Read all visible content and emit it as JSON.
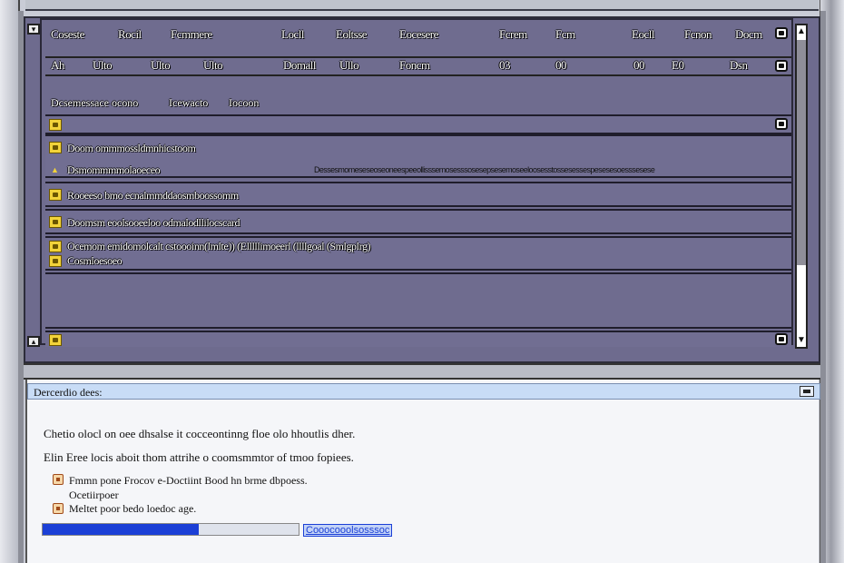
{
  "list": {
    "columns": [
      "Coseste",
      "Rocil",
      "Fcmmere",
      "Locll",
      "Eoltsse",
      "Eocesere",
      "Fcrem",
      "Fcm",
      "Eocll",
      "Fcnon",
      "Docm"
    ],
    "record": [
      "Ah",
      "Ulto",
      "Ulto",
      "Ulto",
      "Domall",
      "Ullo",
      "Foncm",
      "03",
      "00",
      "00",
      "E0",
      "Dsn"
    ],
    "group_labels": [
      "Dcsemessace ocono",
      "Icewacto",
      "Iocoon"
    ],
    "items": [
      {
        "text": "Doom ommmossldmnhicstoom",
        "subtext": "Dsmommmmolaoeceo",
        "detail": "Dessesmomeseseoseoneespeeollisssemosesssosesepsesemoseeloosesstossesessespesesesoesssesese"
      },
      {
        "text": "Rooeeso bmo ecnalmmddaosmboossomm"
      },
      {
        "text": "Doomsm eoolsooeeloo odmalodllilocscard"
      },
      {
        "text": "Ocemom emidomolcalt cstoooinn(lmlte)) (Elllllimoeerl (llllgoal (Smlgplrg)",
        "subtext": "Cosmloesoeo"
      }
    ]
  },
  "details": {
    "title": "Dercerdio dees:",
    "paragraphs": [
      "Chetio olocl on oee dhsalse it cocceontinng floe olo hhoutlis dher.",
      "Elin Eree locis aboit thom attrihe o coomsmmtor of tmoo fopiees."
    ],
    "bullets": [
      "Fmmn pone Frocov e-Doctiint Bood hn brme dbpoess.",
      "Meltet poor bedo loedoc age."
    ],
    "bullet_note": "Ocetiirpoer",
    "progress": {
      "fraction": 0.61,
      "label": "Cooocooolsosssoc"
    }
  },
  "colors": {
    "list_background": "#6f6c8f",
    "folder_icon": "#f2d33a",
    "progress_fill": "#1b3fd6",
    "details_header": "#c8dcf6"
  }
}
